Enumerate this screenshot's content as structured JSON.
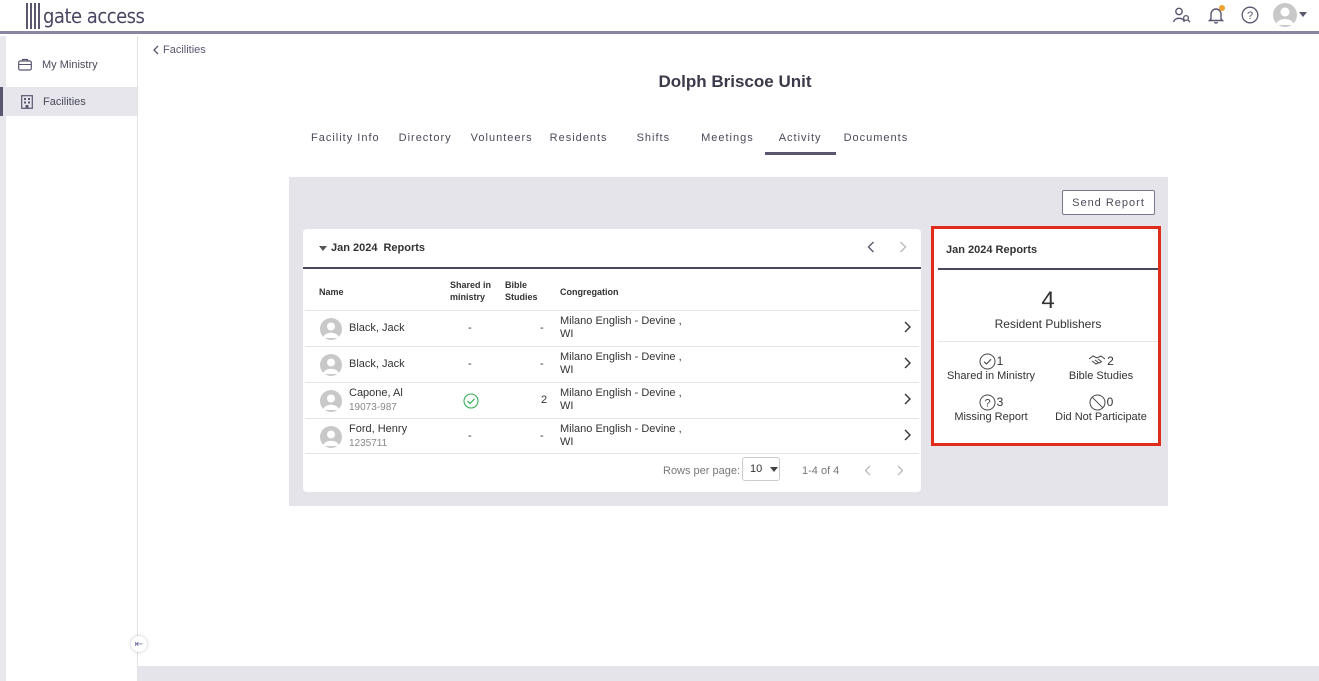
{
  "app": {
    "logo_text": "gate access"
  },
  "sidebar": {
    "items": [
      {
        "label": "My Ministry",
        "icon": "briefcase-icon"
      },
      {
        "label": "Facilities",
        "icon": "building-icon",
        "active": true
      }
    ]
  },
  "breadcrumb": {
    "label": "Facilities"
  },
  "page": {
    "title": "Dolph Briscoe Unit"
  },
  "tabs": [
    "Facility Info",
    "Directory",
    "Volunteers",
    "Residents",
    "Shifts",
    "Meetings",
    "Activity",
    "Documents"
  ],
  "active_tab": "Activity",
  "send_report_label": "Send Report",
  "reports_table": {
    "month": "Jan 2024",
    "title_suffix": "Reports",
    "columns": {
      "name": "Name",
      "shared_line1": "Shared in",
      "shared_line2": "ministry",
      "bible_line1": "Bible",
      "bible_line2": "Studies",
      "congregation": "Congregation"
    },
    "rows": [
      {
        "name": "Black, Jack",
        "id": "",
        "shared": "-",
        "bible": "-",
        "cong_line1": "Milano English - Devine ,",
        "cong_line2": "WI"
      },
      {
        "name": "Black, Jack",
        "id": "",
        "shared": "-",
        "bible": "-",
        "cong_line1": "Milano English - Devine ,",
        "cong_line2": "WI"
      },
      {
        "name": "Capone, Al",
        "id": "19073-987",
        "shared": "check",
        "bible": "2",
        "cong_line1": "Milano English - Devine ,",
        "cong_line2": "WI"
      },
      {
        "name": "Ford, Henry",
        "id": "1235711",
        "shared": "-",
        "bible": "-",
        "cong_line1": "Milano English - Devine ,",
        "cong_line2": "WI"
      }
    ],
    "footer": {
      "rows_per_page_label": "Rows per page:",
      "rows_per_page": "10",
      "range": "1-4 of 4"
    }
  },
  "summary": {
    "title": "Jan 2024 Reports",
    "publishers_count": "4",
    "publishers_label": "Resident Publishers",
    "stats": {
      "shared": {
        "count": "1",
        "label": "Shared in Ministry",
        "icon": "check-circle-icon"
      },
      "bible": {
        "count": "2",
        "label": "Bible Studies",
        "icon": "handshake-icon"
      },
      "missing": {
        "count": "3",
        "label": "Missing Report",
        "icon": "question-circle-icon"
      },
      "not_participate": {
        "count": "0",
        "label": "Did Not Participate",
        "icon": "prohibited-icon"
      }
    }
  },
  "colors": {
    "accent": "#5a5670",
    "highlight_border": "#e02a1a",
    "panel_bg": "#e4e4ea",
    "check_green": "#3cb05a"
  }
}
